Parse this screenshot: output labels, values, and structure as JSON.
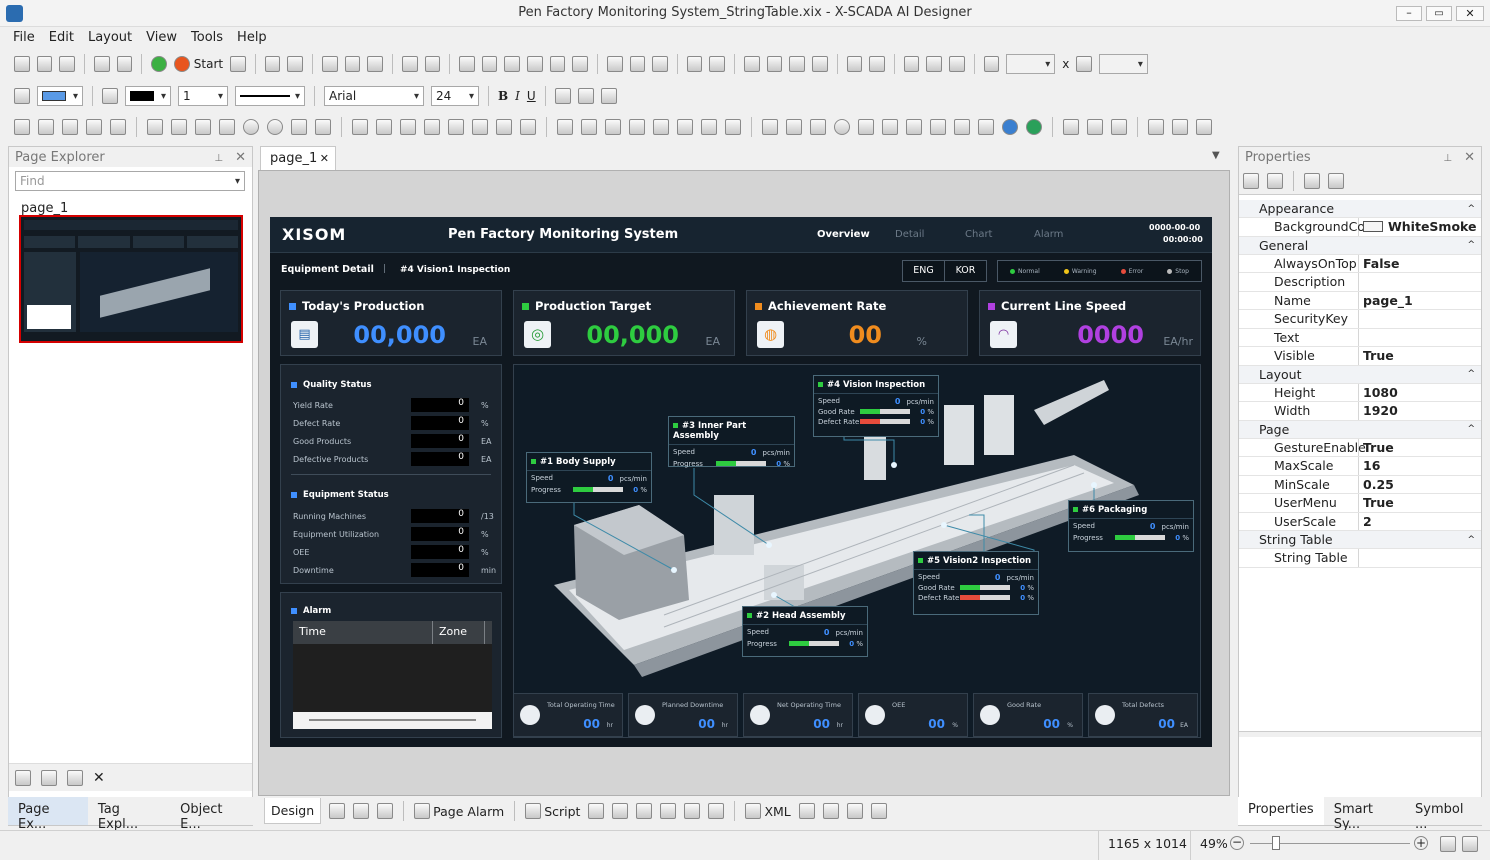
{
  "window": {
    "title": "Pen Factory Monitoring System_StringTable.xix - X-SCADA AI Designer",
    "controls": [
      "minimize",
      "maximize",
      "close"
    ]
  },
  "menu": [
    "File",
    "Edit",
    "Layout",
    "View",
    "Tools",
    "Help"
  ],
  "toolbar": {
    "start_label": "Start",
    "width_value": "",
    "x_label": "x",
    "height_value": "",
    "line_width": "1",
    "font_family": "Arial",
    "font_size": "24"
  },
  "colors": {
    "accent": "#2b6cb0",
    "selection_red": "#d40000",
    "canvas_bg": "#101820",
    "production_blue": "#3f8fff",
    "target_green": "#2ecc40",
    "achievement_orange": "#f08c1e",
    "speed_purple": "#b040e0"
  },
  "page_explorer": {
    "title": "Page Explorer",
    "find_placeholder": "Find",
    "page_name": "page_1",
    "tabs": [
      "Page Ex...",
      "Tag Expl...",
      "Object E..."
    ]
  },
  "document_tab": {
    "label": "page_1"
  },
  "scada": {
    "logo": "XISOM",
    "title": "Pen Factory Monitoring System",
    "nav": [
      "Overview",
      "Detail",
      "Chart",
      "Alarm"
    ],
    "date": "0000-00-00",
    "time": "00:00:00",
    "breadcrumb": {
      "section": "Equipment Detail",
      "item": "#4 Vision1 Inspection"
    },
    "lang": [
      "ENG",
      "KOR"
    ],
    "legend": [
      {
        "label": "Normal",
        "color": "#2ecc40"
      },
      {
        "label": "Warning",
        "color": "#f0c419"
      },
      {
        "label": "Error",
        "color": "#e74c3c"
      },
      {
        "label": "Stop",
        "color": "#bbbbbb"
      }
    ],
    "kpis": [
      {
        "title": "Today's Production",
        "value": "00,000",
        "unit": "EA",
        "color": "#3f8fff",
        "icon": "clipboard-icon"
      },
      {
        "title": "Production Target",
        "value": "00,000",
        "unit": "EA",
        "color": "#2ecc40",
        "icon": "target-icon"
      },
      {
        "title": "Achievement Rate",
        "value": "00",
        "unit": "%",
        "color": "#f08c1e",
        "icon": "donut-icon"
      },
      {
        "title": "Current Line Speed",
        "value": "0000",
        "unit": "EA/hr",
        "color": "#b040e0",
        "icon": "gauge-icon"
      }
    ],
    "quality": {
      "title": "Quality Status",
      "rows": [
        {
          "label": "Yield Rate",
          "value": "0",
          "unit": "%"
        },
        {
          "label": "Defect Rate",
          "value": "0",
          "unit": "%"
        },
        {
          "label": "Good Products",
          "value": "0",
          "unit": "EA"
        },
        {
          "label": "Defective Products",
          "value": "0",
          "unit": "EA"
        }
      ]
    },
    "equipment": {
      "title": "Equipment Status",
      "rows": [
        {
          "label": "Running Machines",
          "value": "0",
          "unit": "/13"
        },
        {
          "label": "Equipment Utilization",
          "value": "0",
          "unit": "%"
        },
        {
          "label": "OEE",
          "value": "0",
          "unit": "%"
        },
        {
          "label": "Downtime",
          "value": "0",
          "unit": "min"
        }
      ]
    },
    "alarm": {
      "title": "Alarm",
      "columns": [
        "Time",
        "Zone"
      ]
    },
    "stations": [
      {
        "name": "#1 Body Supply",
        "speed_label": "Speed",
        "speed": "0",
        "speed_unit": "pcs/min",
        "progress_label": "Progress",
        "progress": "0",
        "pct": "%"
      },
      {
        "name": "#3 Inner Part Assembly",
        "speed_label": "Speed",
        "speed": "0",
        "speed_unit": "pcs/min",
        "progress_label": "Progress",
        "progress": "0",
        "pct": "%"
      },
      {
        "name": "#4 Vision Inspection",
        "speed_label": "Speed",
        "speed": "0",
        "speed_unit": "pcs/min",
        "good_label": "Good Rate",
        "good": "0",
        "defect_label": "Defect Rate",
        "defect": "0",
        "pct": "%"
      },
      {
        "name": "#6 Packaging",
        "speed_label": "Speed",
        "speed": "0",
        "speed_unit": "pcs/min",
        "progress_label": "Progress",
        "progress": "0",
        "pct": "%"
      },
      {
        "name": "#5 Vision2 Inspection",
        "speed_label": "Speed",
        "speed": "0",
        "speed_unit": "pcs/min",
        "good_label": "Good Rate",
        "good": "0",
        "defect_label": "Defect Rate",
        "defect": "0",
        "pct": "%"
      },
      {
        "name": "#2 Head Assembly",
        "speed_label": "Speed",
        "speed": "0",
        "speed_unit": "pcs/min",
        "progress_label": "Progress",
        "progress": "0",
        "pct": "%"
      }
    ],
    "bottom_kpis": [
      {
        "title": "Total Operating Time",
        "value": "00",
        "unit": "hr",
        "icon": "clock-icon"
      },
      {
        "title": "Planned Downtime",
        "value": "00",
        "unit": "hr",
        "icon": "pause-icon"
      },
      {
        "title": "Net Operating Time",
        "value": "00",
        "unit": "hr",
        "icon": "play-icon"
      },
      {
        "title": "OEE",
        "value": "00",
        "unit": "%",
        "icon": "ring-icon"
      },
      {
        "title": "Good Rate",
        "value": "00",
        "unit": "%",
        "icon": "thumb-icon"
      },
      {
        "title": "Total Defects",
        "value": "00",
        "unit": "EA",
        "icon": "chart-icon"
      }
    ]
  },
  "design_tabs": {
    "design": "Design",
    "page_alarm": "Page Alarm",
    "script": "Script",
    "xml": "XML"
  },
  "properties": {
    "title": "Properties",
    "sections": [
      {
        "name": "Appearance",
        "rows": [
          {
            "k": "BackgroundColc",
            "v": "WhiteSmoke",
            "swatch": true
          }
        ]
      },
      {
        "name": "General",
        "rows": [
          {
            "k": "AlwaysOnTop",
            "v": "False"
          },
          {
            "k": "Description",
            "v": ""
          },
          {
            "k": "Name",
            "v": "page_1"
          },
          {
            "k": "SecurityKey",
            "v": ""
          },
          {
            "k": "Text",
            "v": ""
          },
          {
            "k": "Visible",
            "v": "True"
          }
        ]
      },
      {
        "name": "Layout",
        "rows": [
          {
            "k": "Height",
            "v": "1080"
          },
          {
            "k": "Width",
            "v": "1920"
          }
        ]
      },
      {
        "name": "Page",
        "rows": [
          {
            "k": "GestureEnable",
            "v": "True"
          },
          {
            "k": "MaxScale",
            "v": "16"
          },
          {
            "k": "MinScale",
            "v": "0.25"
          },
          {
            "k": "UserMenu",
            "v": "True"
          },
          {
            "k": "UserScale",
            "v": "2"
          }
        ]
      },
      {
        "name": "String Table",
        "rows": [
          {
            "k": "String Table",
            "v": ""
          }
        ]
      }
    ],
    "tabs": [
      "Properties",
      "Smart Sy...",
      "Symbol ..."
    ]
  },
  "status": {
    "size": "1165 x 1014",
    "zoom": "49%",
    "zoom_level": 0.49
  }
}
